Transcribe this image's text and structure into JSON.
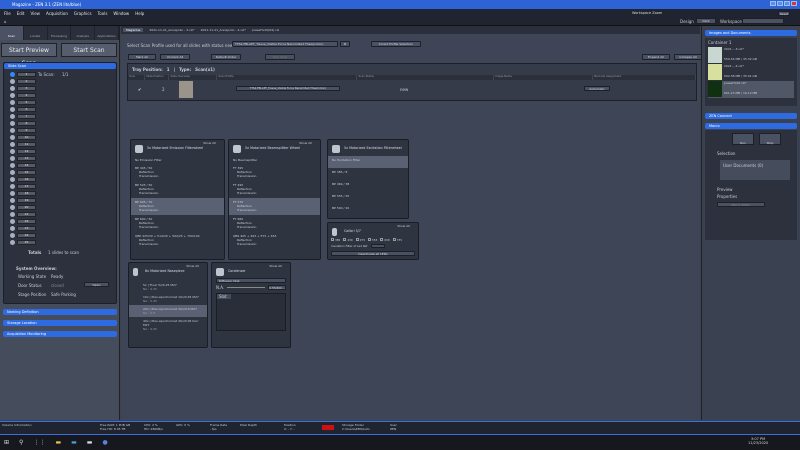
{
  "window": {
    "title": "Magazine - ZEN 3.1 (ZEN lite/blue)"
  },
  "menu": [
    "File",
    "Edit",
    "View",
    "Acquisition",
    "Graphics",
    "Tools",
    "Window",
    "Help"
  ],
  "top_right": {
    "workspace_zoom": "Workspace Zoom",
    "reset": "Reset",
    "design_label": "Design",
    "design_value": "Dark",
    "workspace_label": "Workspace"
  },
  "left": {
    "tabs": [
      "Scan",
      "Locate",
      "Processing",
      "Analysis",
      "Applications"
    ],
    "start_preview": "Start Preview Scan",
    "start_scan": "Start Scan",
    "slide_scan_header": "Slide Scan",
    "to_scan_label": "To Scan:",
    "to_scan_value": "1/1",
    "slots": [
      "1",
      "2",
      "3",
      "4",
      "5",
      "6",
      "7",
      "8",
      "9",
      "10",
      "11",
      "12",
      "13",
      "14",
      "15",
      "16",
      "17",
      "18",
      "19",
      "20",
      "21",
      "22",
      "23",
      "24",
      "25"
    ],
    "totals_label": "Totals",
    "totals_value": "1 slides to scan",
    "system_overview": "System Overview:",
    "working_state_label": "Working State",
    "working_state": "Ready",
    "door_status_label": "Door Status",
    "door_status": "closed",
    "open_button": "Open",
    "stage_position_label": "Stage Position",
    "stage_position": "Safe Parking",
    "sections": [
      "Naming Definition",
      "Storage Location",
      "Acquisition Monitoring"
    ]
  },
  "center": {
    "doc_tabs": [
      "Magazine",
      "2021-11-21_Annapolio - 3.czi*",
      "2021-11-21_Annapolio - 4.czi*",
      "preset%20(04).czi"
    ],
    "select_profile_label": "Select Scan Profile used for all slides with status new",
    "profile_value": "TTS2-FBLAPT_Tissue_Visible Force Nanomilled Thaw(colon)",
    "smart_profile": "Smart Profile Selection",
    "mark_all": "Mark All",
    "unmark_all": "Unmark All",
    "default_order": "Default Order",
    "skip_slide": "Skip Slide",
    "expand_all": "Expand All",
    "collapse_all": "Collapse All",
    "tray_position_label": "Tray Position:",
    "tray_position": "1",
    "type_label": "Type:",
    "type_value": "Scan(x1)",
    "columns": [
      "Scan",
      "Slide Position",
      "Slide Overview",
      "Scan Profile",
      "Scan Status",
      "Image Name",
      "Barcode Assignment"
    ],
    "row": {
      "slide_position": "2",
      "scan_profile": "TTS2-FBLAPT_Tissue_Visible Force Nanomilled Thaw(colon)",
      "scan_status": "new",
      "barcode": "Automatic"
    }
  },
  "filters": {
    "show_all": "Show All",
    "emission": {
      "title": "5x Motorized Emission Filterwheel",
      "subtitle": "No Emission Filter",
      "items": [
        {
          "name": "BP 445 / 50",
          "swatches": [
            [
              "#2040e0"
            ]
          ]
        },
        {
          "name": "BP 525 / 50",
          "swatches": [
            [
              "#30d030"
            ]
          ]
        },
        {
          "name": "BP 605 / 70",
          "swatches": [
            [
              "#e08020"
            ]
          ],
          "selected": true
        },
        {
          "name": "BP 690 / 50",
          "swatches": [
            [
              "#e02020"
            ]
          ]
        },
        {
          "name": "QBP 425/30 + 514/30 + 592/25 + 709/100",
          "swatches": [
            [
              "#6020d0",
              "#30d030",
              "#e04010",
              "#700010"
            ]
          ]
        }
      ]
    },
    "beamsplitter": {
      "title": "5x Motorized Beamsplitter Wheel",
      "subtitle": "No Beamsplitter",
      "items": [
        {
          "name": "FT 395",
          "swatches": [
            [
              "#602060"
            ],
            [
              "#e0e020"
            ]
          ]
        },
        {
          "name": "FT 495",
          "swatches": [
            [
              "#2040e0"
            ],
            [
              "#d02020"
            ]
          ]
        },
        {
          "name": "FT 570",
          "swatches": [
            [
              "#30d030"
            ],
            [
              "#e08020"
            ]
          ],
          "selected": true
        },
        {
          "name": "FT 660",
          "swatches": [
            [
              "#d02020"
            ],
            [
              "#e02020"
            ]
          ]
        },
        {
          "name": "QBS 405 + 493 + 575 + 653",
          "swatches": [
            [
              "#602060",
              "#2090e0",
              "#e0e020",
              "#c01010",
              "#500010"
            ],
            [
              "#6020d0",
              "#30d030",
              "#d02020",
              "#500010"
            ]
          ]
        }
      ]
    },
    "excitation": {
      "title": "5x Motorized Excitation Filterwheel",
      "items": [
        "No Excitation Filter",
        "BP 385 / 8",
        "BP 469 / 38",
        "BP 555 / 25",
        "BP 590 / 20"
      ]
    },
    "labels": {
      "reflection": "Reflection",
      "transmission": "Transmission"
    },
    "colibri": {
      "title": "Colibri 5/7",
      "leds": [
        "385",
        "430",
        "475",
        "555",
        "630",
        "735"
      ],
      "led_suffix": "LEDs",
      "insulation_label": "Insulation Filter of Led Ref",
      "deactivate": "Deactivate all LEDs"
    },
    "nosepiece": {
      "title": "6x Motorized Nosepiece",
      "items": [
        {
          "name": "5x  |  Fluar 5x/0.25 M27",
          "sub": "NA : 0.25"
        },
        {
          "name": "10x  |  Plan-Apochromat 10x/0.45 M27",
          "sub": "NA : 0.45"
        },
        {
          "name": "20x  |  Plan-Apochromat 20x/0.8 M27",
          "sub": "NA : 0.8",
          "selected": true
        },
        {
          "name": "40x  |  Plan-Apochromat 40x/0.95 Korr M27",
          "sub": "NA : 0.95"
        }
      ]
    },
    "condenser": {
      "title": "Condenser",
      "mode": "Diffusion Disk",
      "na_label": "N.A.",
      "na_value": "0.55/DIC...",
      "list_header": "Slot"
    }
  },
  "right": {
    "images_header": "Images and Documents",
    "container": "Container 1",
    "docs": [
      {
        "name": "2021....3.czi*",
        "size": "559.34 MB / 35.32 GB"
      },
      {
        "name": "2021....4.czi*",
        "size": "502.38 MB / 35.01 GB"
      },
      {
        "name": "preset%20.czi*",
        "size": "601.23 MB / 19.12 MB"
      }
    ],
    "zen_connect": "ZEN Connect",
    "macro": "Macro",
    "run": "Run",
    "stop": "Stop",
    "selection": "Selection",
    "user_documents": "User Documents (0)",
    "preview": "Preview",
    "properties": "Properties",
    "macro_editor": "Macro Editor"
  },
  "status": {
    "volume": "Volume Information",
    "build": "Free RAM: 1 PUB GB",
    "free_hd": "Free HD: 8.35 TB",
    "cpu": "CPU: 2 %",
    "cpu_graph": "HD: 280KB/s",
    "gpu": "GPU: 0 %",
    "frame_rate": "Frame Rate",
    "frame_value": "- fps",
    "pixel_depth": "Pixel Depth",
    "position": "Position",
    "position_value": "X: - Y: -",
    "storage": "Storage Folder",
    "storage_value": "C:\\Users\\ZEN\\Auto",
    "user": "User",
    "user_value": "ZEN"
  },
  "taskbar": {
    "time": "3:07 PM",
    "date": "11/23/2020"
  }
}
